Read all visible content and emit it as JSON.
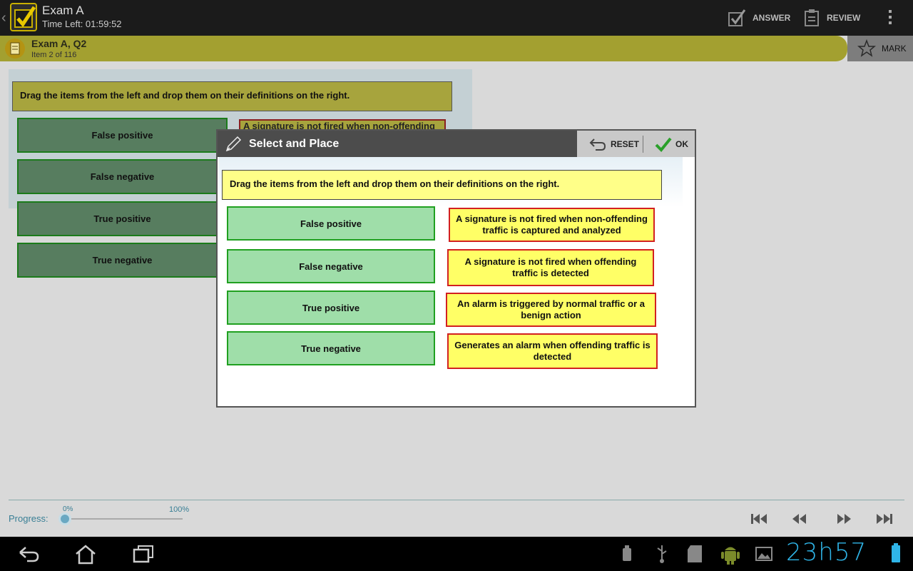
{
  "actionbar": {
    "title": "Exam A",
    "time_left": "Time Left: 01:59:52",
    "answer_label": "ANSWER",
    "review_label": "REVIEW"
  },
  "question_bar": {
    "title": "Exam A, Q2",
    "subtitle": "Item 2 of 116",
    "mark_label": "MARK"
  },
  "background_question": {
    "instruction": "Drag the items from the left and drop them on their definitions on the right.",
    "items": [
      "False positive",
      "False negative",
      "True positive",
      "True negative"
    ],
    "partial_definition": "A signature is not fired when non-offending"
  },
  "dialog": {
    "title": "Select and Place",
    "reset_label": "RESET",
    "ok_label": "OK",
    "instruction": "Drag the items from the left and drop them on their definitions on the right.",
    "items": [
      {
        "label": "False positive"
      },
      {
        "label": "False negative"
      },
      {
        "label": "True positive"
      },
      {
        "label": "True negative"
      }
    ],
    "definitions": [
      {
        "text": "A signature is not fired when non-offending traffic is captured and analyzed"
      },
      {
        "text": "A signature is not fired when offending traffic is detected"
      },
      {
        "text": "An alarm is triggered by normal traffic or a benign action"
      },
      {
        "text": "Generates an alarm when offending traffic is detected"
      }
    ]
  },
  "progress": {
    "label": "Progress:",
    "min_label": "0%",
    "max_label": "100%",
    "value": 0.02
  },
  "system_bar": {
    "clock": "23h57"
  },
  "colors": {
    "accent": "#2fb5e8",
    "item_fill": "#9fdea9",
    "definition_fill": "#ffff66",
    "instruction_fill": "#ffff88"
  }
}
